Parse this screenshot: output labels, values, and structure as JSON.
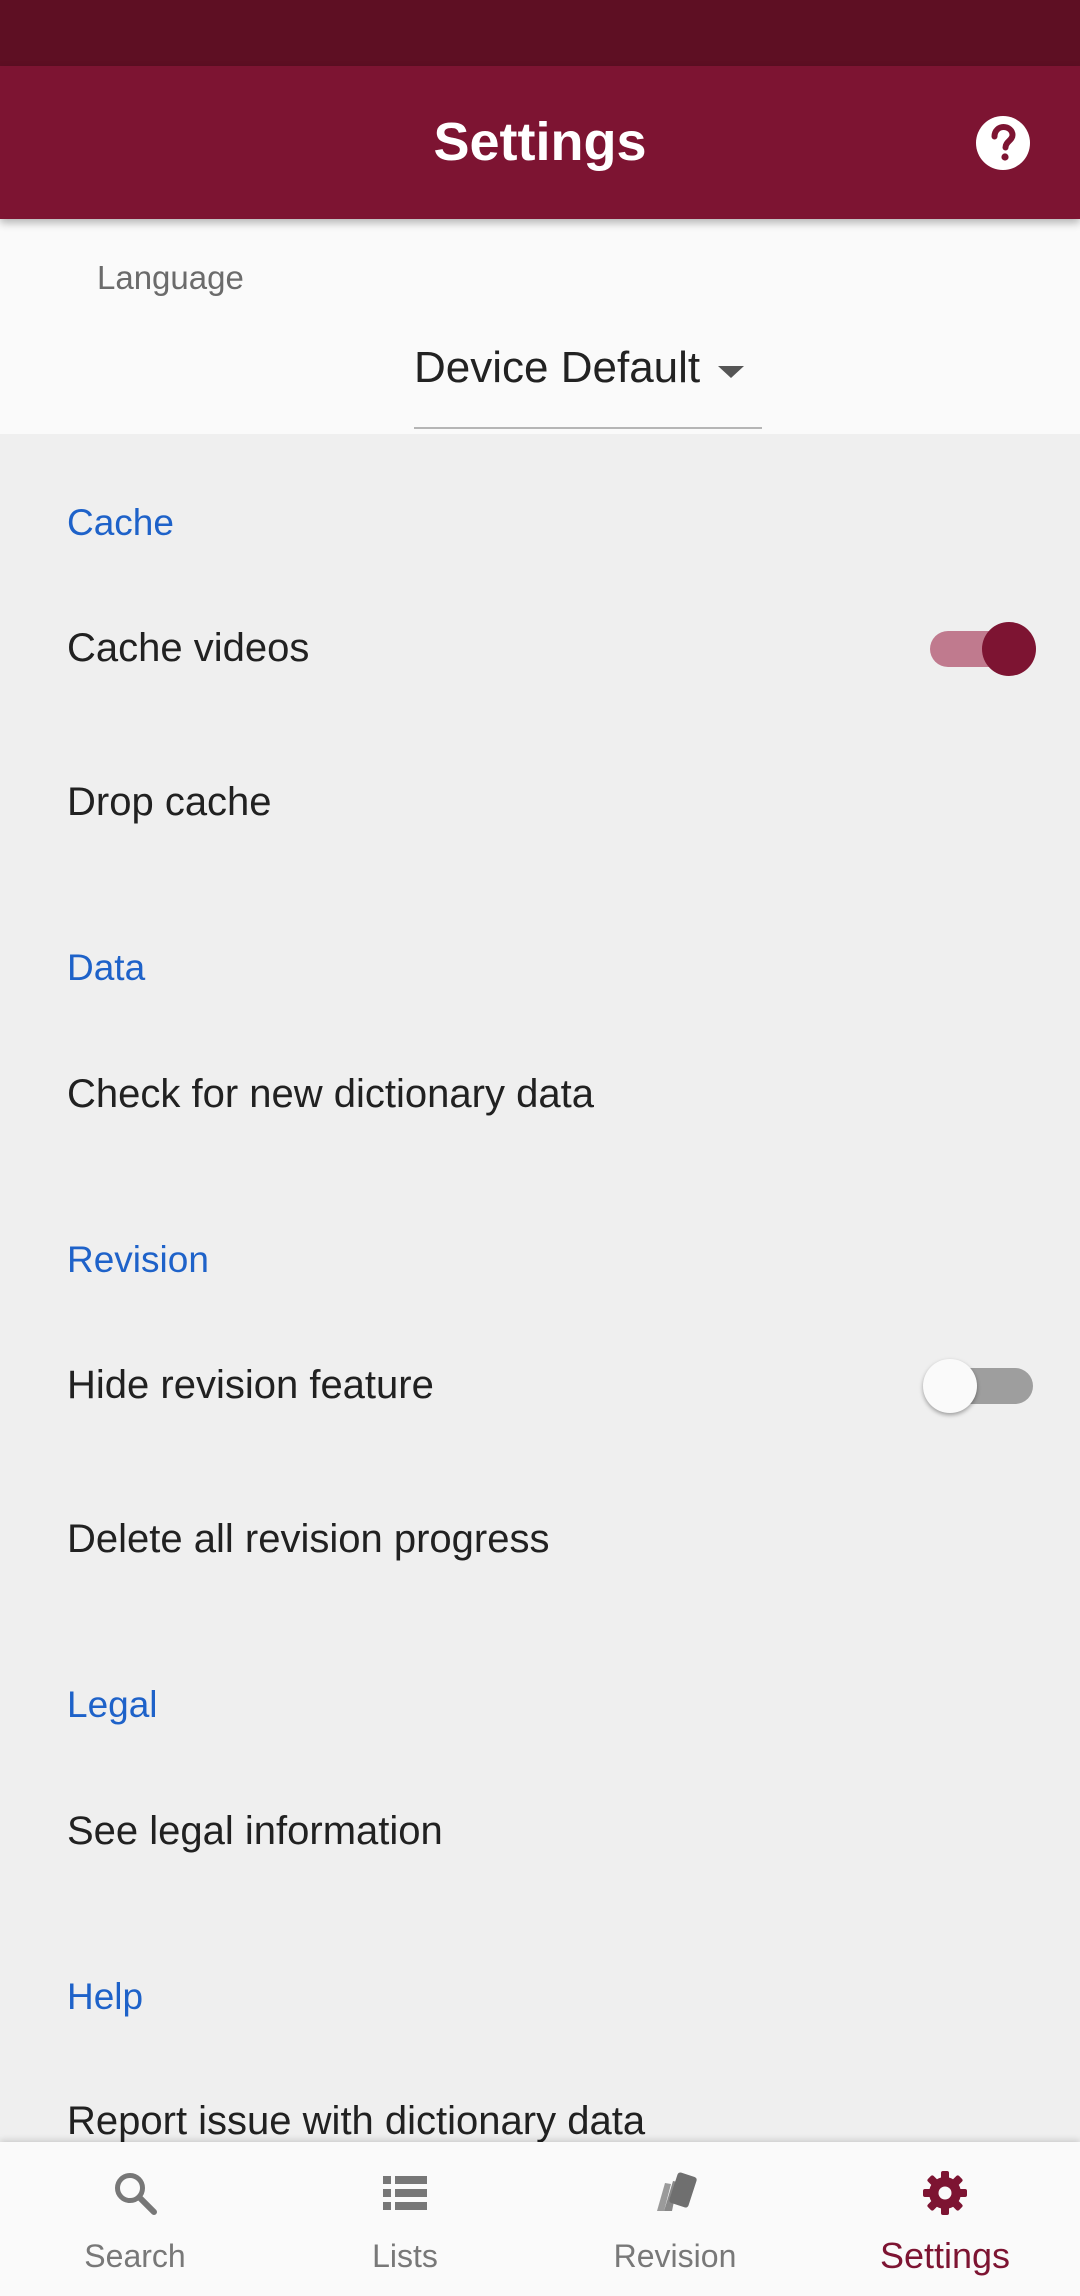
{
  "app_bar": {
    "title": "Settings",
    "help_icon": "help-circle-icon"
  },
  "language": {
    "label": "Language",
    "value": "Device Default"
  },
  "sections": {
    "cache": {
      "header": "Cache",
      "cache_videos": {
        "label": "Cache videos",
        "enabled": true
      },
      "drop_cache": {
        "label": "Drop cache"
      }
    },
    "data": {
      "header": "Data",
      "check_new_data": {
        "label": "Check for new dictionary data"
      }
    },
    "revision": {
      "header": "Revision",
      "hide_revision": {
        "label": "Hide revision feature",
        "enabled": false
      },
      "delete_progress": {
        "label": "Delete all revision progress"
      }
    },
    "legal": {
      "header": "Legal",
      "see_legal": {
        "label": "See legal information"
      }
    },
    "help": {
      "header": "Help",
      "report_issue": {
        "label": "Report issue with dictionary data"
      }
    }
  },
  "bottom_nav": {
    "search": {
      "label": "Search",
      "icon": "search-icon"
    },
    "lists": {
      "label": "Lists",
      "icon": "list-icon"
    },
    "revision": {
      "label": "Revision",
      "icon": "cards-icon"
    },
    "settings": {
      "label": "Settings",
      "icon": "gear-icon",
      "active": true
    }
  },
  "colors": {
    "status_bar": "#5e0f23",
    "primary": "#7d1432",
    "section_header": "#1e62c9",
    "background": "#efefef"
  }
}
